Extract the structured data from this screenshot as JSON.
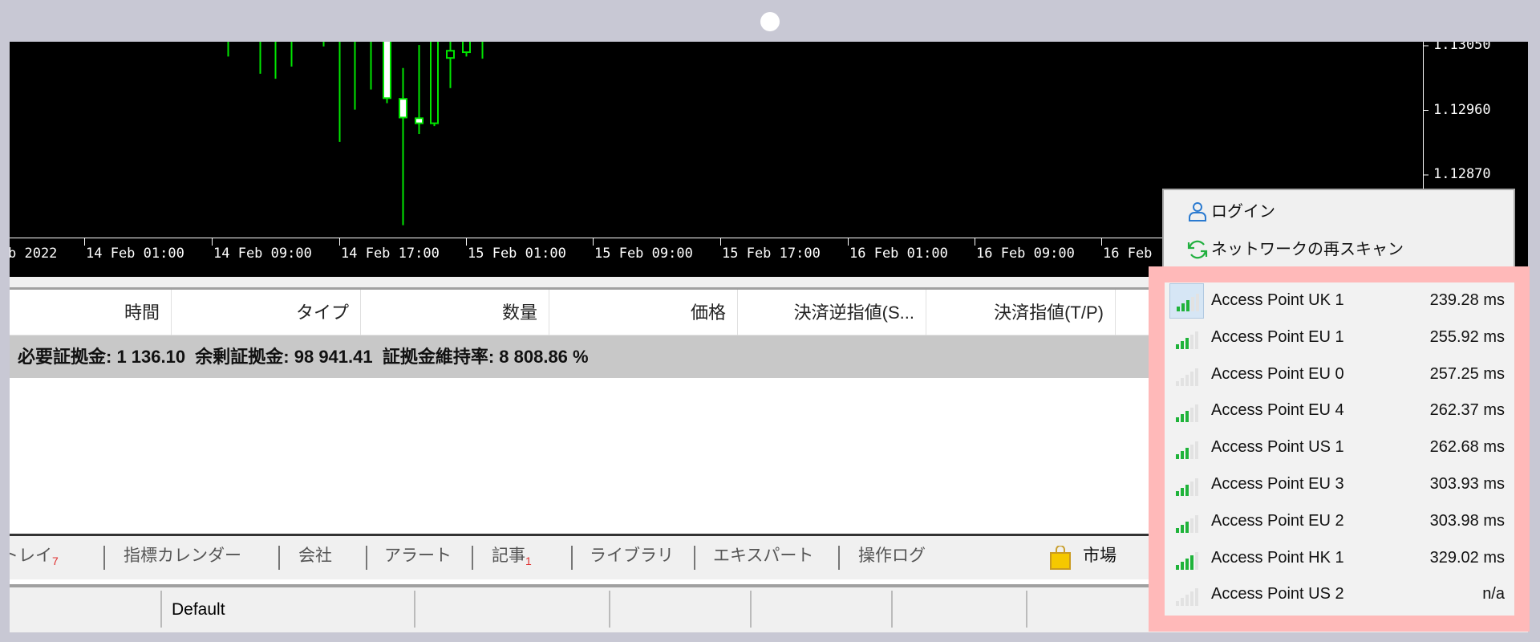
{
  "chart_data": {
    "type": "candlestick",
    "price_ticks": [
      "1.13050",
      "1.12960",
      "1.12870"
    ],
    "time_labels": [
      "b 2022",
      "14 Feb 01:00",
      "14 Feb 09:00",
      "14 Feb 17:00",
      "15 Feb 01:00",
      "15 Feb 09:00",
      "15 Feb 17:00",
      "16 Feb 01:00",
      "16 Feb 09:00",
      "16 Feb"
    ],
    "colors": {
      "background": "#000000",
      "candle": "#00e600",
      "bull_fill": "#ffffff",
      "bear_fill": "#000000",
      "axis": "#ffffff"
    },
    "candles": [
      {
        "o": 1.1308,
        "h": 1.131,
        "l": 1.13035,
        "c": 1.1309
      },
      null,
      {
        "o": 1.1308,
        "h": 1.131,
        "l": 1.13011,
        "c": 1.1309
      },
      {
        "o": 1.1308,
        "h": 1.131,
        "l": 1.13004,
        "c": 1.1309
      },
      {
        "o": 1.1308,
        "h": 1.131,
        "l": 1.13021,
        "c": 1.1309
      },
      null,
      {
        "o": 1.1308,
        "h": 1.131,
        "l": 1.13049,
        "c": 1.1309
      },
      {
        "o": 1.1308,
        "h": 1.131,
        "l": 1.12916,
        "c": 1.1309
      },
      {
        "o": 1.1308,
        "h": 1.131,
        "l": 1.12961,
        "c": 1.1309
      },
      {
        "o": 1.1308,
        "h": 1.131,
        "l": 1.12989,
        "c": 1.1309
      },
      {
        "o": 1.12977,
        "h": 1.131,
        "l": 1.1297,
        "c": 1.1308
      },
      {
        "o": 1.1295,
        "h": 1.13019,
        "l": 1.128,
        "c": 1.12976
      },
      {
        "o": 1.12942,
        "h": 1.13051,
        "l": 1.12927,
        "c": 1.12949
      },
      {
        "o": 1.1308,
        "h": 1.131,
        "l": 1.12938,
        "c": 1.12942
      },
      {
        "o": 1.13043,
        "h": 1.131,
        "l": 1.12991,
        "c": 1.13033
      },
      {
        "o": 1.1308,
        "h": 1.131,
        "l": 1.13035,
        "c": 1.13041
      },
      {
        "o": 1.1308,
        "h": 1.131,
        "l": 1.13032,
        "c": 1.1309
      }
    ]
  },
  "table": {
    "headers": [
      "時間",
      "タイプ",
      "数量",
      "価格",
      "決済逆指値(S...",
      "決済指値(T/P)"
    ]
  },
  "summary": "必要証拠金: 1 136.10  余剰証拠金: 98 941.41  証拠金維持率: 8 808.86 %",
  "tabs": [
    {
      "label": "受信トレイ",
      "badge": "7"
    },
    {
      "label": "指標カレンダー"
    },
    {
      "label": "会社"
    },
    {
      "label": "アラート"
    },
    {
      "label": "記事",
      "badge": "1"
    },
    {
      "label": "ライブラリ"
    },
    {
      "label": "エキスパート"
    },
    {
      "label": "操作ログ"
    }
  ],
  "market": {
    "label": "市場",
    "icon": "shopping-bag-icon"
  },
  "status": {
    "profile": "Default"
  },
  "menu": {
    "login": {
      "label": "ログイン",
      "icon": "user-icon"
    },
    "rescan": {
      "label": "ネットワークの再スキャン",
      "icon": "refresh-icon"
    }
  },
  "access_points": [
    {
      "name": "Access Point UK 1",
      "ping": "239.28 ms",
      "signal": 3,
      "selected": true
    },
    {
      "name": "Access Point EU 1",
      "ping": "255.92 ms",
      "signal": 3
    },
    {
      "name": "Access Point EU 0",
      "ping": "257.25 ms",
      "signal": 0
    },
    {
      "name": "Access Point EU 4",
      "ping": "262.37 ms",
      "signal": 3
    },
    {
      "name": "Access Point US 1",
      "ping": "262.68 ms",
      "signal": 3
    },
    {
      "name": "Access Point EU 3",
      "ping": "303.93 ms",
      "signal": 3
    },
    {
      "name": "Access Point EU 2",
      "ping": "303.98 ms",
      "signal": 3
    },
    {
      "name": "Access Point HK 1",
      "ping": "329.02 ms",
      "signal": 4
    },
    {
      "name": "Access Point US 2",
      "ping": "n/a",
      "signal": 0
    }
  ],
  "colors": {
    "highlight": "#ffb9b9",
    "signal_on": "#1fb33a",
    "signal_off": "#e2e2e2"
  }
}
